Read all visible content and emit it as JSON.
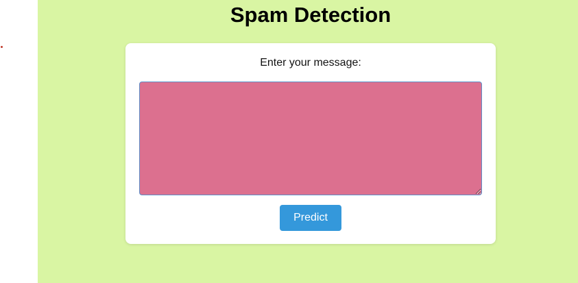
{
  "page": {
    "title": "Spam Detection"
  },
  "form": {
    "label": "Enter your message:",
    "message_value": "",
    "predict_label": "Predict"
  },
  "colors": {
    "background": "#d9f5a3",
    "card": "#ffffff",
    "textarea": "#dc708f",
    "button": "#3498db"
  }
}
